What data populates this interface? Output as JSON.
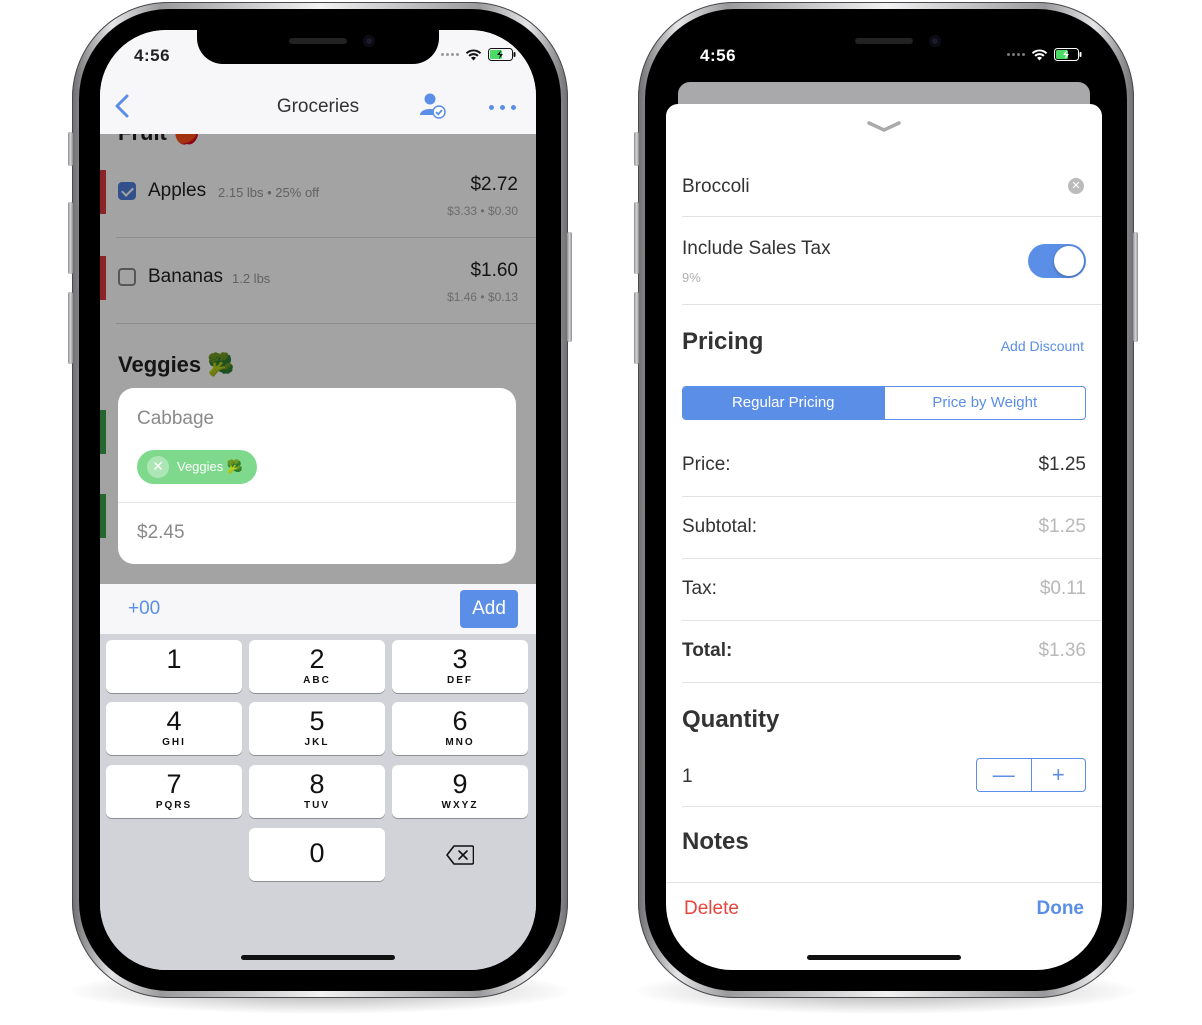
{
  "left_phone": {
    "status": {
      "time": "4:56"
    },
    "nav": {
      "title": "Groceries"
    },
    "sections": {
      "fruit_title": "Fruit 🍎",
      "veggies_title": "Veggies 🥦"
    },
    "items": [
      {
        "name": "Apples",
        "meta": "2.15 lbs • 25% off",
        "price": "$2.72",
        "sub": "$3.33 • $0.30",
        "checked": true,
        "stripe_color": "#d93a3a"
      },
      {
        "name": "Bananas",
        "meta": "1.2 lbs",
        "price": "$1.60",
        "sub": "$1.46 • $0.13",
        "checked": false,
        "stripe_color": "#d93a3a"
      }
    ],
    "add_card": {
      "name": "Cabbage",
      "tag": "Veggies 🥦",
      "price": "$2.45"
    },
    "accessory": {
      "quick_add": "+00",
      "add_button": "Add"
    },
    "keypad": [
      {
        "num": "1",
        "letters": ""
      },
      {
        "num": "2",
        "letters": "ABC"
      },
      {
        "num": "3",
        "letters": "DEF"
      },
      {
        "num": "4",
        "letters": "GHI"
      },
      {
        "num": "5",
        "letters": "JKL"
      },
      {
        "num": "6",
        "letters": "MNO"
      },
      {
        "num": "7",
        "letters": "PQRS"
      },
      {
        "num": "8",
        "letters": "TUV"
      },
      {
        "num": "9",
        "letters": "WXYZ"
      },
      {
        "num": "0",
        "letters": ""
      }
    ]
  },
  "right_phone": {
    "status": {
      "time": "4:56"
    },
    "item_name": "Broccoli",
    "sales_tax": {
      "label": "Include Sales Tax",
      "value": "9%",
      "enabled": true
    },
    "pricing": {
      "heading": "Pricing",
      "add_discount": "Add Discount",
      "segments": [
        "Regular Pricing",
        "Price by Weight"
      ],
      "selected_segment": "Regular Pricing"
    },
    "rows": {
      "price": {
        "label": "Price:",
        "value": "$1.25"
      },
      "subtotal": {
        "label": "Subtotal:",
        "value": "$1.25"
      },
      "tax": {
        "label": "Tax:",
        "value": "$0.11"
      },
      "total": {
        "label": "Total:",
        "value": "$1.36"
      }
    },
    "quantity": {
      "heading": "Quantity",
      "value": "1",
      "minus": "—",
      "plus": "+"
    },
    "notes": {
      "heading": "Notes"
    },
    "footer": {
      "delete": "Delete",
      "done": "Done"
    }
  },
  "colors": {
    "accent": "#5b8ee6",
    "delete_red": "#e5453b",
    "fruit_stripe": "#d93a3a",
    "veggie_stripe": "#3aa04a",
    "tag_green": "#7fd98d"
  },
  "icons": [
    "back-chevron-icon",
    "share-user-icon",
    "more-dots-icon",
    "wifi-icon",
    "battery-charging-icon",
    "checkmark-icon",
    "clear-x-icon",
    "delete-key-icon",
    "sheet-grabber-icon"
  ]
}
